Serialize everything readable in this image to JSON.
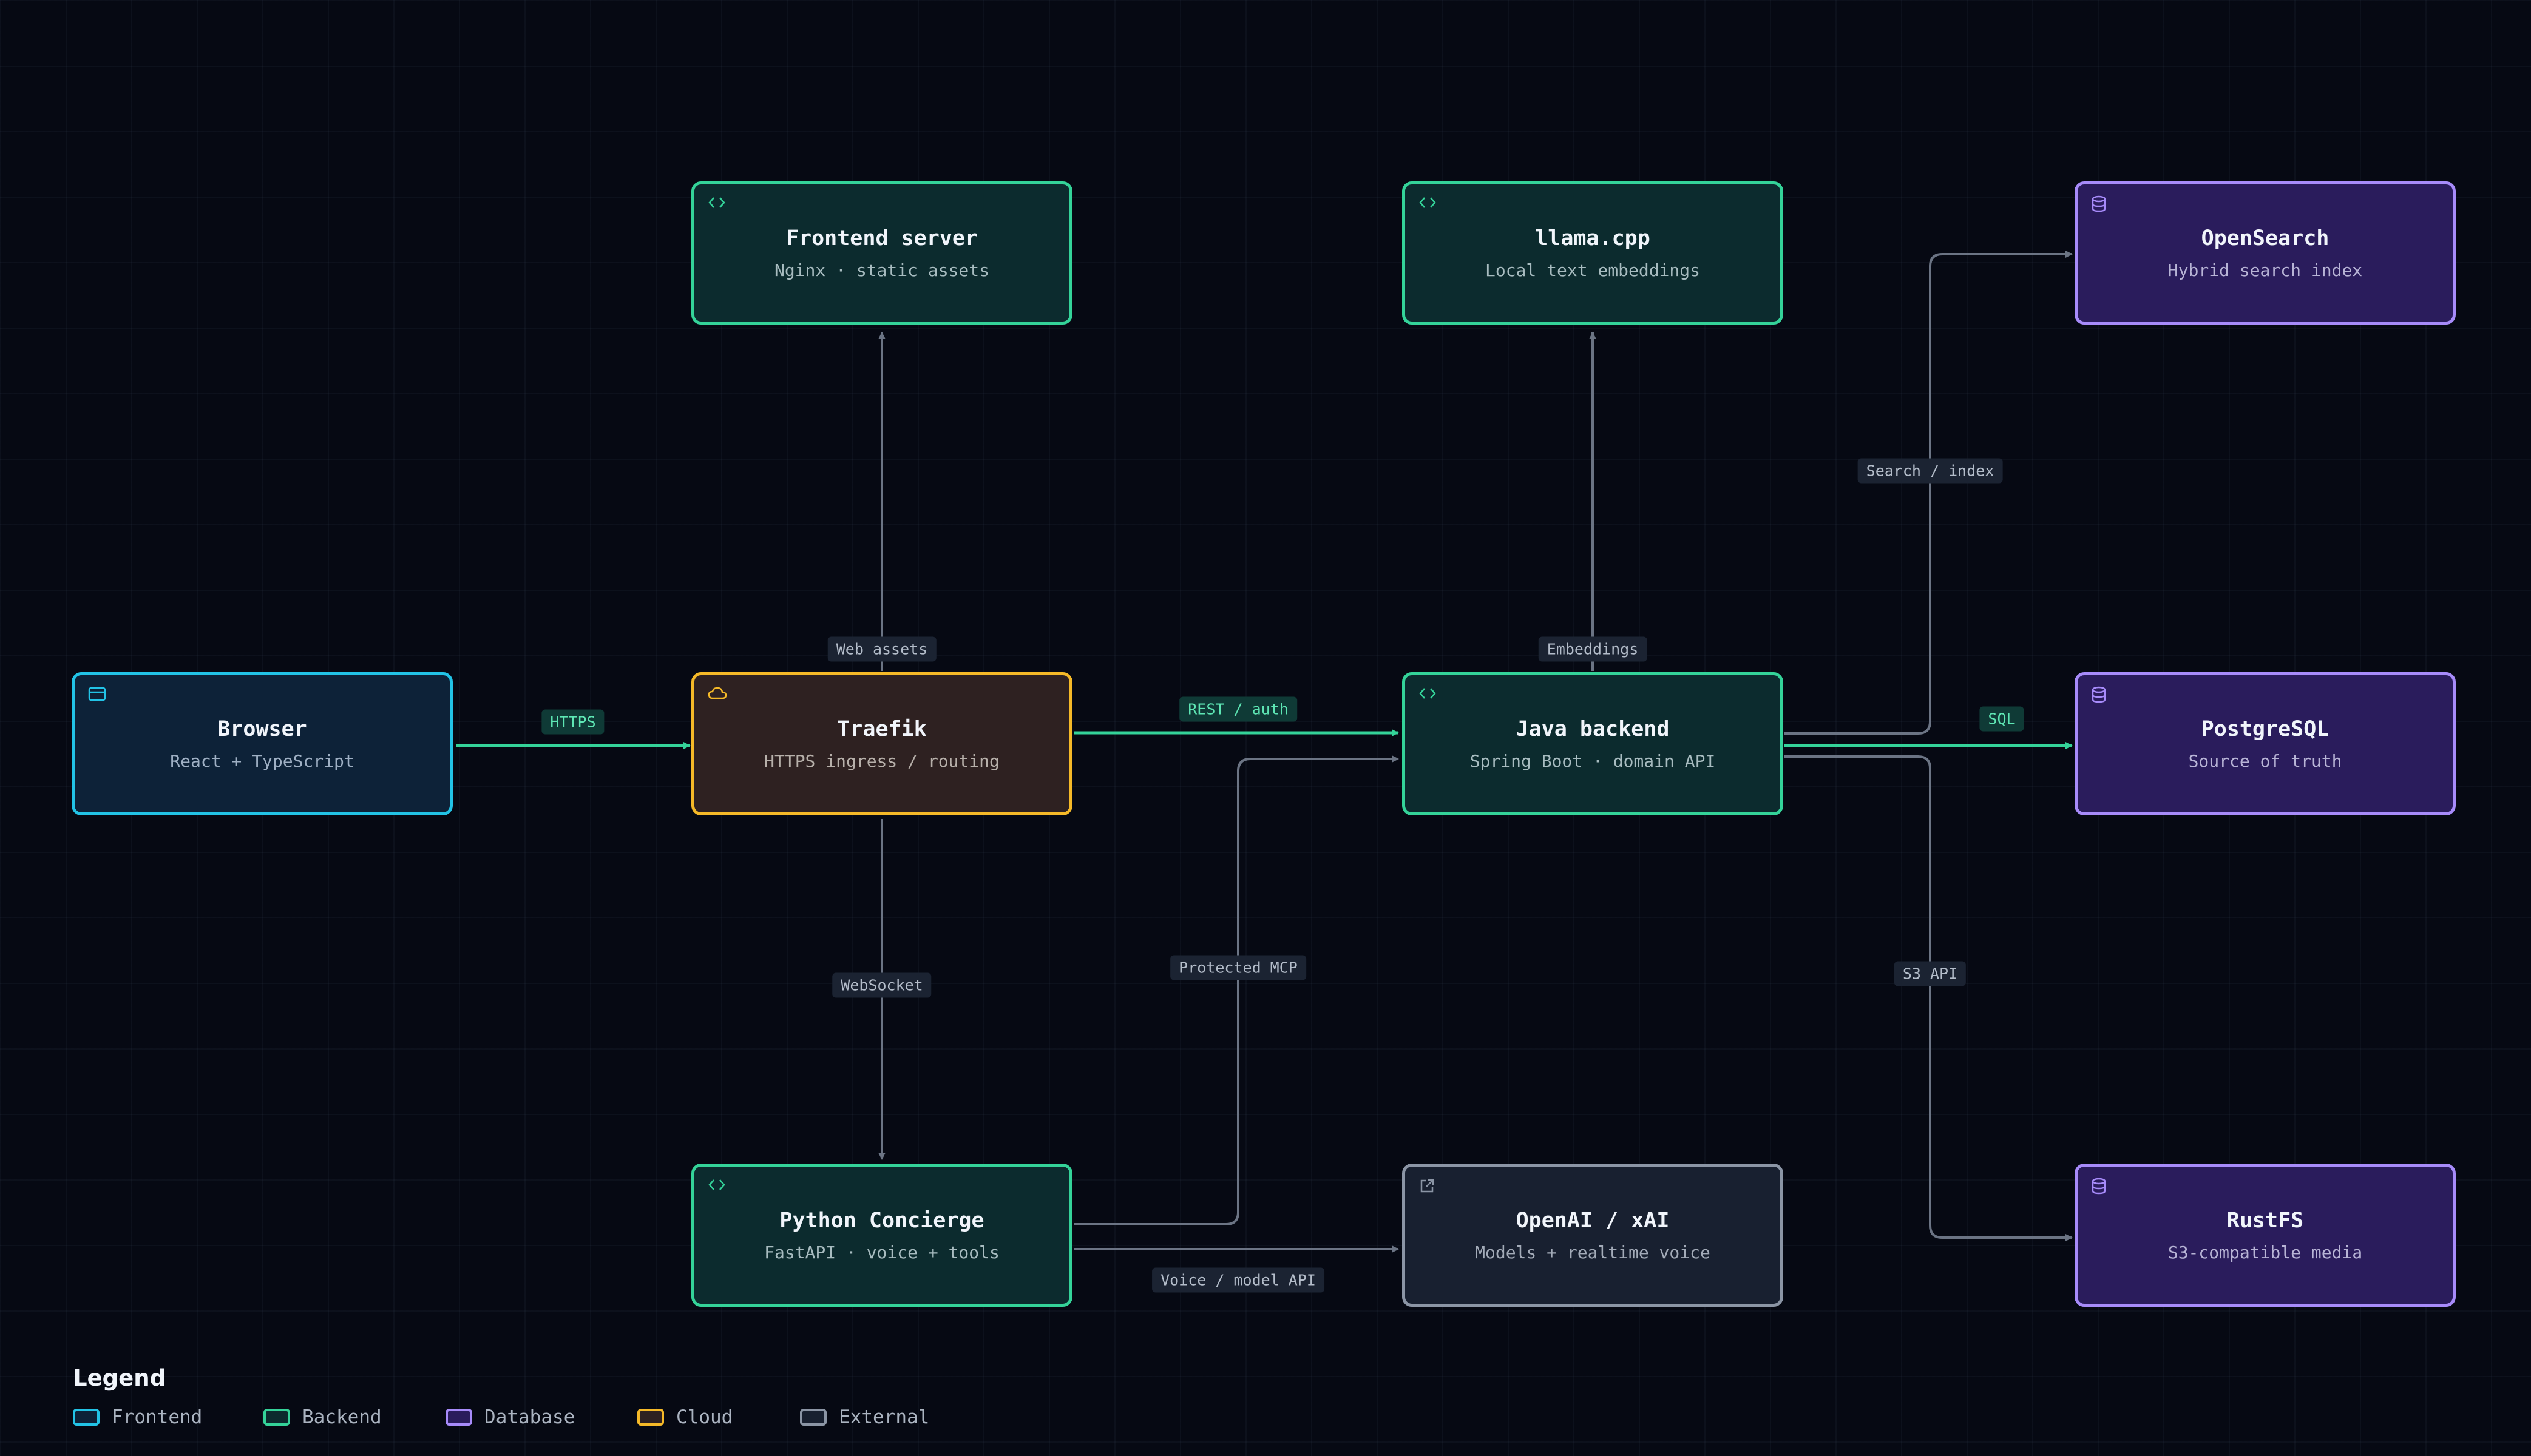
{
  "nodes": {
    "browser": {
      "title": "Browser",
      "subtitle": "React + TypeScript",
      "icon": "window-icon",
      "category": "frontend"
    },
    "traefik": {
      "title": "Traefik",
      "subtitle": "HTTPS ingress / routing",
      "icon": "cloud-icon",
      "category": "cloud"
    },
    "frontend_server": {
      "title": "Frontend server",
      "subtitle": "Nginx · static assets",
      "icon": "code-icon",
      "category": "backend"
    },
    "llama": {
      "title": "llama.cpp",
      "subtitle": "Local text embeddings",
      "icon": "code-icon",
      "category": "backend"
    },
    "java": {
      "title": "Java backend",
      "subtitle": "Spring Boot · domain API",
      "icon": "code-icon",
      "category": "backend"
    },
    "python": {
      "title": "Python Concierge",
      "subtitle": "FastAPI · voice + tools",
      "icon": "code-icon",
      "category": "backend"
    },
    "openai": {
      "title": "OpenAI / xAI",
      "subtitle": "Models + realtime voice",
      "icon": "external-link-icon",
      "category": "external"
    },
    "opensearch": {
      "title": "OpenSearch",
      "subtitle": "Hybrid search index",
      "icon": "database-icon",
      "category": "database"
    },
    "postgres": {
      "title": "PostgreSQL",
      "subtitle": "Source of truth",
      "icon": "database-icon",
      "category": "database"
    },
    "rustfs": {
      "title": "RustFS",
      "subtitle": "S3-compatible media",
      "icon": "database-icon",
      "category": "database"
    }
  },
  "edges": [
    {
      "from": "browser",
      "to": "traefik",
      "label": "HTTPS",
      "primary": true
    },
    {
      "from": "traefik",
      "to": "frontend_server",
      "label": "Web assets",
      "primary": false
    },
    {
      "from": "traefik",
      "to": "java",
      "label": "REST / auth",
      "primary": true
    },
    {
      "from": "traefik",
      "to": "python",
      "label": "WebSocket",
      "primary": false
    },
    {
      "from": "python",
      "to": "java",
      "label": "Protected MCP",
      "primary": false
    },
    {
      "from": "python",
      "to": "openai",
      "label": "Voice / model API",
      "primary": false
    },
    {
      "from": "java",
      "to": "llama",
      "label": "Embeddings",
      "primary": false
    },
    {
      "from": "java",
      "to": "opensearch",
      "label": "Search / index",
      "primary": false
    },
    {
      "from": "java",
      "to": "postgres",
      "label": "SQL",
      "primary": true
    },
    {
      "from": "java",
      "to": "rustfs",
      "label": "S3 API",
      "primary": false
    }
  ],
  "legend": {
    "title": "Legend",
    "items": [
      {
        "label": "Frontend",
        "color": "#22c3e6"
      },
      {
        "label": "Backend",
        "color": "#34d399"
      },
      {
        "label": "Database",
        "color": "#a78bfa"
      },
      {
        "label": "Cloud",
        "color": "#f5b928"
      },
      {
        "label": "External",
        "color": "#8b95a5"
      }
    ]
  },
  "colors": {
    "background": "#060913",
    "primary_edge": "#34d399",
    "secondary_edge": "#6b7484"
  }
}
